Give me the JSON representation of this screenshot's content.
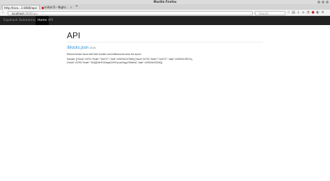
{
  "window": {
    "title": "Mozilla Firefox"
  },
  "tabs": [
    {
      "label": "http://loca...1:8080/api",
      "active": true
    },
    {
      "label": "Initial D - Night...",
      "active": false
    }
  ],
  "navbar": {
    "url_host": "localhost",
    "url_port": ":8080/api",
    "search_placeholder": "Search"
  },
  "site": {
    "brand": "Equihash Solomining",
    "links": [
      {
        "label": "Home",
        "active": true
      },
      {
        "label": "API",
        "active": false
      }
    ]
  },
  "page": {
    "heading": "API",
    "endpoint": "/blocks.json",
    "format": "JSON",
    "description": "Returns blocks found with their founder and milliseconds since the epoch.",
    "sample_line1": "Sample: [{\"block\":44791,\"finder\":\"t1eKTC\",\"date\":1490004137869},{\"block\":44792,\"finder\":\"t1eKTC\",\"date\":1490004198711},",
    "sample_line2": "{\"block\":44793,\"finder\":\"t1NjQDkHFdXAqaG2rHFyvuz2hzgyT6Mehkj\",\"date\":1490004433240}]"
  }
}
